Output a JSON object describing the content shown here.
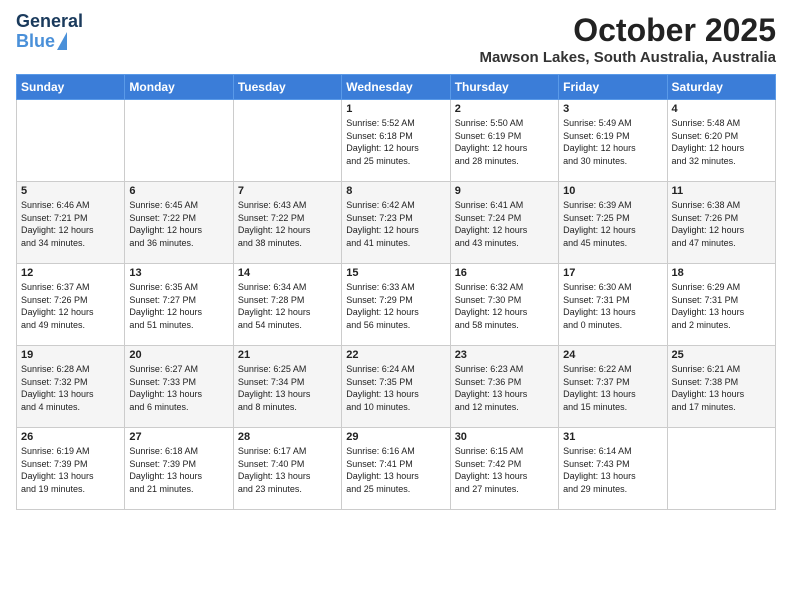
{
  "header": {
    "logo_general": "General",
    "logo_blue": "Blue",
    "month_title": "October 2025",
    "location": "Mawson Lakes, South Australia, Australia"
  },
  "weekdays": [
    "Sunday",
    "Monday",
    "Tuesday",
    "Wednesday",
    "Thursday",
    "Friday",
    "Saturday"
  ],
  "weeks": [
    [
      {
        "day": "",
        "info": ""
      },
      {
        "day": "",
        "info": ""
      },
      {
        "day": "",
        "info": ""
      },
      {
        "day": "1",
        "info": "Sunrise: 5:52 AM\nSunset: 6:18 PM\nDaylight: 12 hours\nand 25 minutes."
      },
      {
        "day": "2",
        "info": "Sunrise: 5:50 AM\nSunset: 6:19 PM\nDaylight: 12 hours\nand 28 minutes."
      },
      {
        "day": "3",
        "info": "Sunrise: 5:49 AM\nSunset: 6:19 PM\nDaylight: 12 hours\nand 30 minutes."
      },
      {
        "day": "4",
        "info": "Sunrise: 5:48 AM\nSunset: 6:20 PM\nDaylight: 12 hours\nand 32 minutes."
      }
    ],
    [
      {
        "day": "5",
        "info": "Sunrise: 6:46 AM\nSunset: 7:21 PM\nDaylight: 12 hours\nand 34 minutes."
      },
      {
        "day": "6",
        "info": "Sunrise: 6:45 AM\nSunset: 7:22 PM\nDaylight: 12 hours\nand 36 minutes."
      },
      {
        "day": "7",
        "info": "Sunrise: 6:43 AM\nSunset: 7:22 PM\nDaylight: 12 hours\nand 38 minutes."
      },
      {
        "day": "8",
        "info": "Sunrise: 6:42 AM\nSunset: 7:23 PM\nDaylight: 12 hours\nand 41 minutes."
      },
      {
        "day": "9",
        "info": "Sunrise: 6:41 AM\nSunset: 7:24 PM\nDaylight: 12 hours\nand 43 minutes."
      },
      {
        "day": "10",
        "info": "Sunrise: 6:39 AM\nSunset: 7:25 PM\nDaylight: 12 hours\nand 45 minutes."
      },
      {
        "day": "11",
        "info": "Sunrise: 6:38 AM\nSunset: 7:26 PM\nDaylight: 12 hours\nand 47 minutes."
      }
    ],
    [
      {
        "day": "12",
        "info": "Sunrise: 6:37 AM\nSunset: 7:26 PM\nDaylight: 12 hours\nand 49 minutes."
      },
      {
        "day": "13",
        "info": "Sunrise: 6:35 AM\nSunset: 7:27 PM\nDaylight: 12 hours\nand 51 minutes."
      },
      {
        "day": "14",
        "info": "Sunrise: 6:34 AM\nSunset: 7:28 PM\nDaylight: 12 hours\nand 54 minutes."
      },
      {
        "day": "15",
        "info": "Sunrise: 6:33 AM\nSunset: 7:29 PM\nDaylight: 12 hours\nand 56 minutes."
      },
      {
        "day": "16",
        "info": "Sunrise: 6:32 AM\nSunset: 7:30 PM\nDaylight: 12 hours\nand 58 minutes."
      },
      {
        "day": "17",
        "info": "Sunrise: 6:30 AM\nSunset: 7:31 PM\nDaylight: 13 hours\nand 0 minutes."
      },
      {
        "day": "18",
        "info": "Sunrise: 6:29 AM\nSunset: 7:31 PM\nDaylight: 13 hours\nand 2 minutes."
      }
    ],
    [
      {
        "day": "19",
        "info": "Sunrise: 6:28 AM\nSunset: 7:32 PM\nDaylight: 13 hours\nand 4 minutes."
      },
      {
        "day": "20",
        "info": "Sunrise: 6:27 AM\nSunset: 7:33 PM\nDaylight: 13 hours\nand 6 minutes."
      },
      {
        "day": "21",
        "info": "Sunrise: 6:25 AM\nSunset: 7:34 PM\nDaylight: 13 hours\nand 8 minutes."
      },
      {
        "day": "22",
        "info": "Sunrise: 6:24 AM\nSunset: 7:35 PM\nDaylight: 13 hours\nand 10 minutes."
      },
      {
        "day": "23",
        "info": "Sunrise: 6:23 AM\nSunset: 7:36 PM\nDaylight: 13 hours\nand 12 minutes."
      },
      {
        "day": "24",
        "info": "Sunrise: 6:22 AM\nSunset: 7:37 PM\nDaylight: 13 hours\nand 15 minutes."
      },
      {
        "day": "25",
        "info": "Sunrise: 6:21 AM\nSunset: 7:38 PM\nDaylight: 13 hours\nand 17 minutes."
      }
    ],
    [
      {
        "day": "26",
        "info": "Sunrise: 6:19 AM\nSunset: 7:39 PM\nDaylight: 13 hours\nand 19 minutes."
      },
      {
        "day": "27",
        "info": "Sunrise: 6:18 AM\nSunset: 7:39 PM\nDaylight: 13 hours\nand 21 minutes."
      },
      {
        "day": "28",
        "info": "Sunrise: 6:17 AM\nSunset: 7:40 PM\nDaylight: 13 hours\nand 23 minutes."
      },
      {
        "day": "29",
        "info": "Sunrise: 6:16 AM\nSunset: 7:41 PM\nDaylight: 13 hours\nand 25 minutes."
      },
      {
        "day": "30",
        "info": "Sunrise: 6:15 AM\nSunset: 7:42 PM\nDaylight: 13 hours\nand 27 minutes."
      },
      {
        "day": "31",
        "info": "Sunrise: 6:14 AM\nSunset: 7:43 PM\nDaylight: 13 hours\nand 29 minutes."
      },
      {
        "day": "",
        "info": ""
      }
    ]
  ]
}
